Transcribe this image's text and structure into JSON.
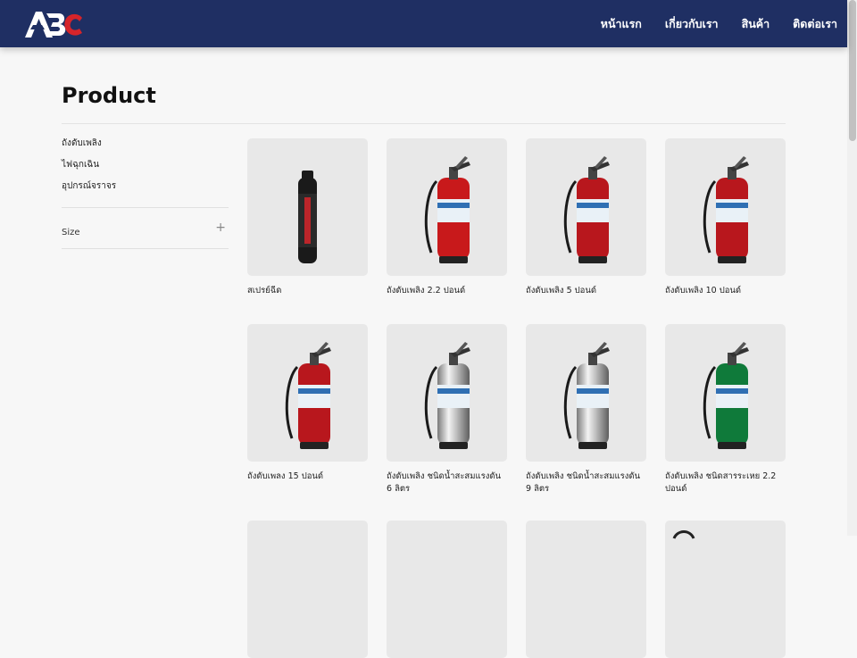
{
  "header": {
    "logo_text": "ABC",
    "nav": [
      {
        "label": "หน้าแรก"
      },
      {
        "label": "เกี่ยวกับเรา"
      },
      {
        "label": "สินค้า"
      },
      {
        "label": "ติดต่อเรา"
      }
    ]
  },
  "main": {
    "title": "Product"
  },
  "sidebar": {
    "categories": [
      {
        "label": "ถังดับเพลิง"
      },
      {
        "label": "ไฟฉุกเฉิน"
      },
      {
        "label": "อุปกรณ์จราจร"
      }
    ],
    "size_filter": {
      "label": "Size",
      "icon": "plus-icon"
    }
  },
  "products": [
    {
      "name": "สเปรย์ฉีด",
      "icon": "spray-can-icon",
      "color": "#1a1a1a"
    },
    {
      "name": "ถังดับเพลิง 2.2 ปอนด์",
      "icon": "extinguisher-icon",
      "color": "#c8191b"
    },
    {
      "name": "ถังดับเพลิง 5 ปอนด์",
      "icon": "extinguisher-icon",
      "color": "#b8171d"
    },
    {
      "name": "ถังดับเพลิง 10 ปอนด์",
      "icon": "extinguisher-icon",
      "color": "#b8171d"
    },
    {
      "name": "ถังดับเพลง 15 ปอนด์",
      "icon": "extinguisher-icon",
      "color": "#b8171d"
    },
    {
      "name": "ถังดับเพลิง ชนิดน้ำสะสมแรงดัน 6 ลิตร",
      "icon": "extinguisher-icon",
      "color": "#c9c9c9"
    },
    {
      "name": "ถังดับเพลิง ชนิดน้ำสะสมแรงดัน 9 ลิตร",
      "icon": "extinguisher-icon",
      "color": "#c9c9c9"
    },
    {
      "name": "ถังดับเพลิง ชนิดสารระเหย 2.2 ปอนด์",
      "icon": "extinguisher-icon",
      "color": "#0f7a3a"
    }
  ],
  "colors": {
    "header_bg": "#1f2f63",
    "logo_accent": "#d6242a",
    "card_bg": "#e8e8e8"
  }
}
